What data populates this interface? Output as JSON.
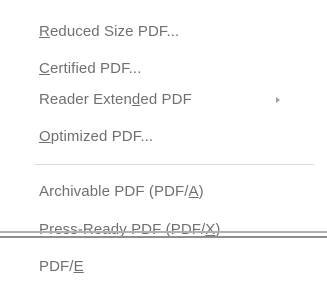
{
  "menu": {
    "items": [
      {
        "pre": "",
        "mn": "R",
        "post": "educed Size PDF..."
      },
      {
        "pre": "",
        "mn": "C",
        "post": "ertified PDF..."
      },
      {
        "pre": "Reader Exten",
        "mn": "d",
        "post": "ed PDF"
      },
      {
        "pre": "",
        "mn": "O",
        "post": "ptimized PDF..."
      },
      {
        "pre": "Archivable PDF (PDF/",
        "mn": "A",
        "post": ")"
      },
      {
        "pre": "Press-Ready PDF (PDF/",
        "mn": "X",
        "post": ")"
      },
      {
        "pre": "PDF/",
        "mn": "E",
        "post": ""
      }
    ],
    "submenu_icon": "chevron-right-icon",
    "text_color": "#707070"
  }
}
